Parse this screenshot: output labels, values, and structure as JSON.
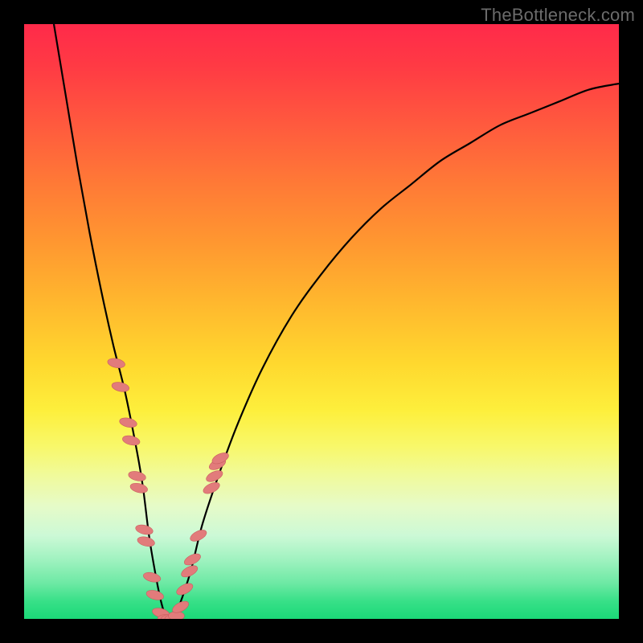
{
  "watermark": "TheBottleneck.com",
  "colors": {
    "background_frame": "#000000",
    "gradient_top": "#ff2a4a",
    "gradient_bottom": "#1bd978",
    "curve": "#000000",
    "markers": "#e27b7b",
    "marker_stroke": "#c95f5f"
  },
  "chart_data": {
    "type": "line",
    "title": "",
    "xlabel": "",
    "ylabel": "",
    "xlim": [
      0,
      100
    ],
    "ylim": [
      0,
      100
    ],
    "grid": false,
    "legend": false,
    "notes": "V-shaped curve on rainbow gradient; no axis ticks or labels are visible. Values are estimated from pixel positions; y increases downward in rendering but here reported as bottleneck-severity from 0 (green/bottom) to 100 (red/top).",
    "series": [
      {
        "name": "curve",
        "x": [
          5,
          7,
          9,
          11,
          13,
          15,
          17,
          19,
          20,
          21,
          22,
          23,
          24,
          25,
          26,
          28,
          30,
          33,
          36,
          40,
          45,
          50,
          55,
          60,
          65,
          70,
          75,
          80,
          85,
          90,
          95,
          100
        ],
        "y": [
          100,
          88,
          76,
          65,
          55,
          46,
          38,
          28,
          22,
          14,
          8,
          3,
          0,
          0,
          2,
          8,
          16,
          25,
          33,
          42,
          51,
          58,
          64,
          69,
          73,
          77,
          80,
          83,
          85,
          87,
          89,
          90
        ]
      }
    ],
    "markers": {
      "description": "Coral oval markers clustered along the lower V region of the curve",
      "shape": "oval",
      "points_left": [
        {
          "x": 15.5,
          "y": 43
        },
        {
          "x": 16.2,
          "y": 39
        },
        {
          "x": 17.5,
          "y": 33
        },
        {
          "x": 18.0,
          "y": 30
        },
        {
          "x": 19.0,
          "y": 24
        },
        {
          "x": 19.3,
          "y": 22
        },
        {
          "x": 20.2,
          "y": 15
        },
        {
          "x": 20.5,
          "y": 13
        },
        {
          "x": 21.5,
          "y": 7
        },
        {
          "x": 22.0,
          "y": 4
        },
        {
          "x": 23.0,
          "y": 1
        }
      ],
      "points_bottom": [
        {
          "x": 23.8,
          "y": 0
        },
        {
          "x": 24.4,
          "y": 0
        },
        {
          "x": 25.0,
          "y": 0
        },
        {
          "x": 25.6,
          "y": 0.5
        }
      ],
      "points_right": [
        {
          "x": 26.3,
          "y": 2
        },
        {
          "x": 27.0,
          "y": 5
        },
        {
          "x": 27.8,
          "y": 8
        },
        {
          "x": 28.3,
          "y": 10
        },
        {
          "x": 29.3,
          "y": 14
        },
        {
          "x": 31.5,
          "y": 22
        },
        {
          "x": 32.0,
          "y": 24
        },
        {
          "x": 32.5,
          "y": 26
        },
        {
          "x": 33.0,
          "y": 27
        }
      ]
    }
  }
}
